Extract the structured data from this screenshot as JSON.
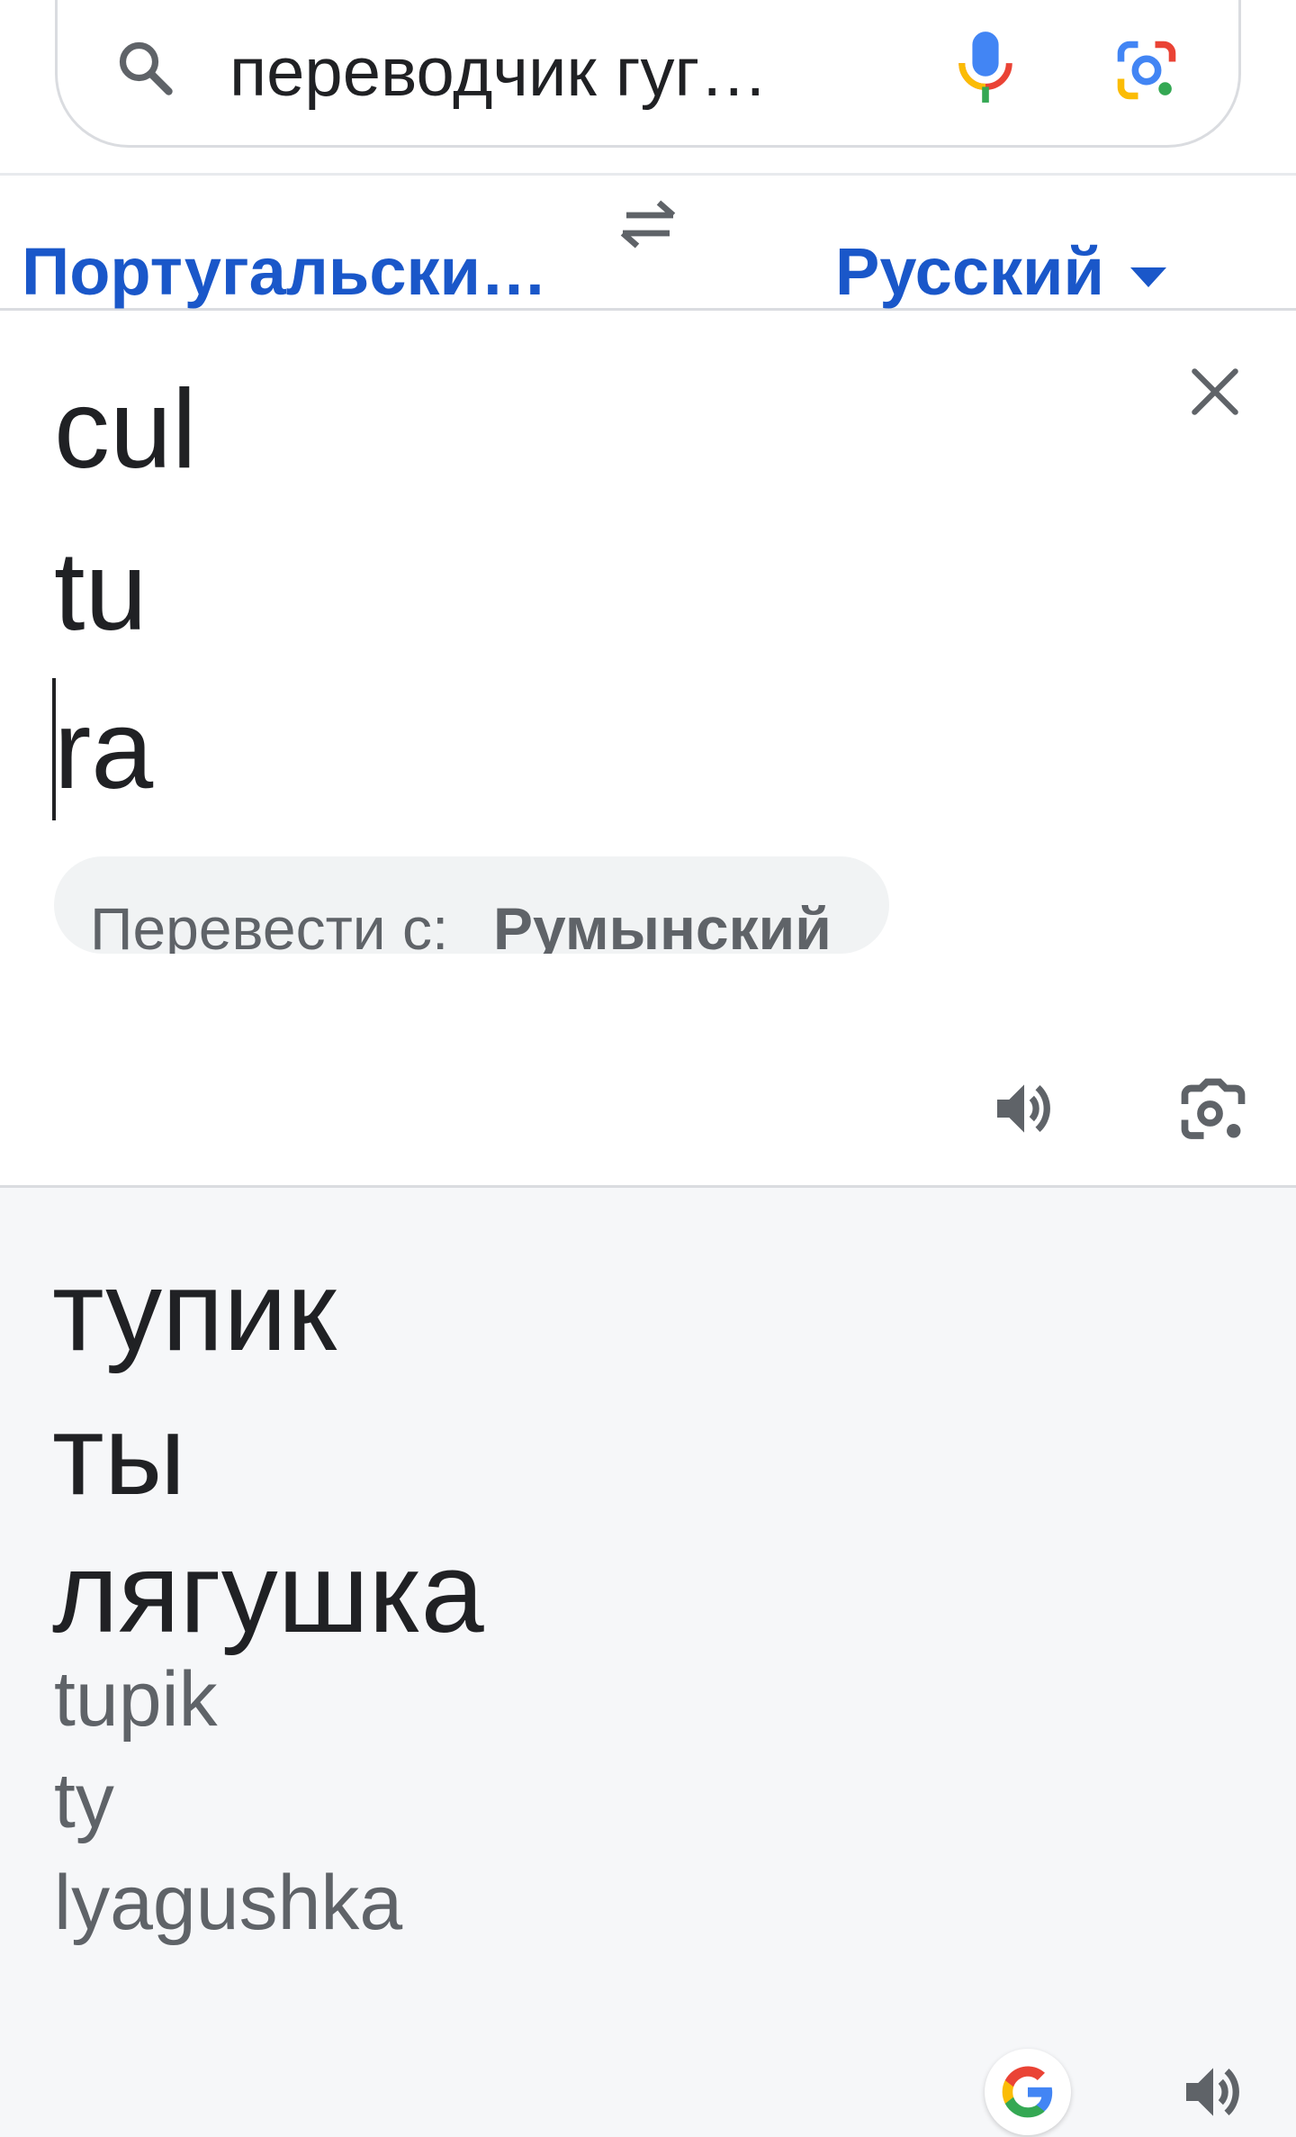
{
  "search": {
    "query": "переводчик гуг…",
    "icons": [
      "search-icon",
      "mic-icon",
      "lens-icon"
    ]
  },
  "languages": {
    "source": "Португальски…",
    "target": "Русский",
    "icons": [
      "swap-icon",
      "dropdown-icon"
    ]
  },
  "input": {
    "lines": [
      "cul",
      "tu",
      "ra"
    ],
    "detect_prefix": "Перевести с:",
    "detect_language": "Румынский",
    "icons": [
      "clear-icon",
      "speaker-icon",
      "camera-icon"
    ]
  },
  "output": {
    "lines": [
      "тупик",
      "ты",
      "лягушка"
    ],
    "transliteration": [
      "tupik",
      "ty",
      "lyagushka"
    ],
    "icons": [
      "google-g-icon",
      "speaker-icon"
    ]
  },
  "colors": {
    "link_blue": "#1a57c9",
    "output_bg": "#f6f7f9",
    "chip_bg": "#f1f3f4"
  }
}
